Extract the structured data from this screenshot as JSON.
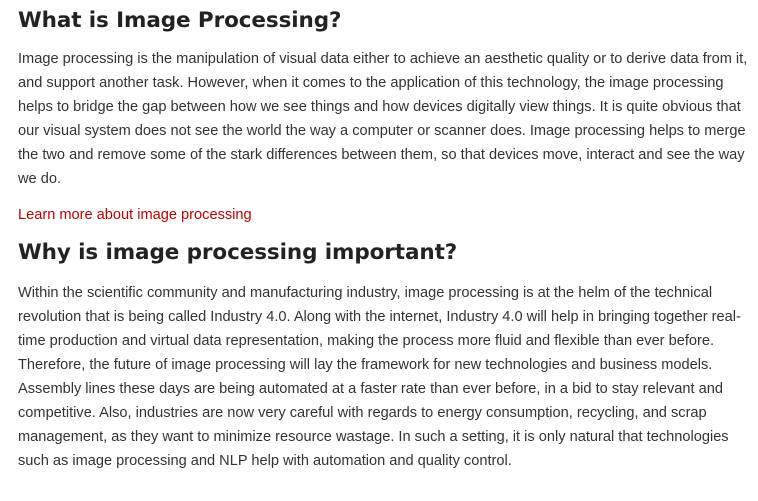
{
  "article": {
    "section1": {
      "heading": "What is Image Processing?",
      "body": "Image processing is the manipulation of visual data either to achieve an aesthetic quality or to derive data from it, and support another task. However, when it comes to the application of this technology, the image processing helps to bridge the gap between how we see things and how devices digitally view things. It is quite obvious that our visual system does not see the world the way a computer or scanner does. Image processing helps to merge the two and remove some of the stark differences between them, so that devices move, interact and see the way we do.",
      "link_label": "Learn more about image processing"
    },
    "section2": {
      "heading": "Why is image processing important?",
      "body": "Within the scientific community and manufacturing industry, image processing is at the helm of the technical revolution that is being called Industry 4.0. Along with the internet, Industry 4.0 will help in bringing together real-time production and virtual data representation, making the process more fluid and flexible than ever before. Therefore, the future of image processing will lay the framework for new technologies and business models. Assembly lines these days are being automated at a faster rate than ever before, in a bid to stay relevant and competitive. Also, industries are now very careful with regards to energy consumption, recycling, and scrap management, as they want to minimize resource wastage. In such a setting, it is only natural that technologies such as image processing and NLP help with automation and quality control."
    }
  },
  "colors": {
    "heading": "#222222",
    "body_text": "#333333",
    "link": "#c00000",
    "background": "#ffffff"
  }
}
